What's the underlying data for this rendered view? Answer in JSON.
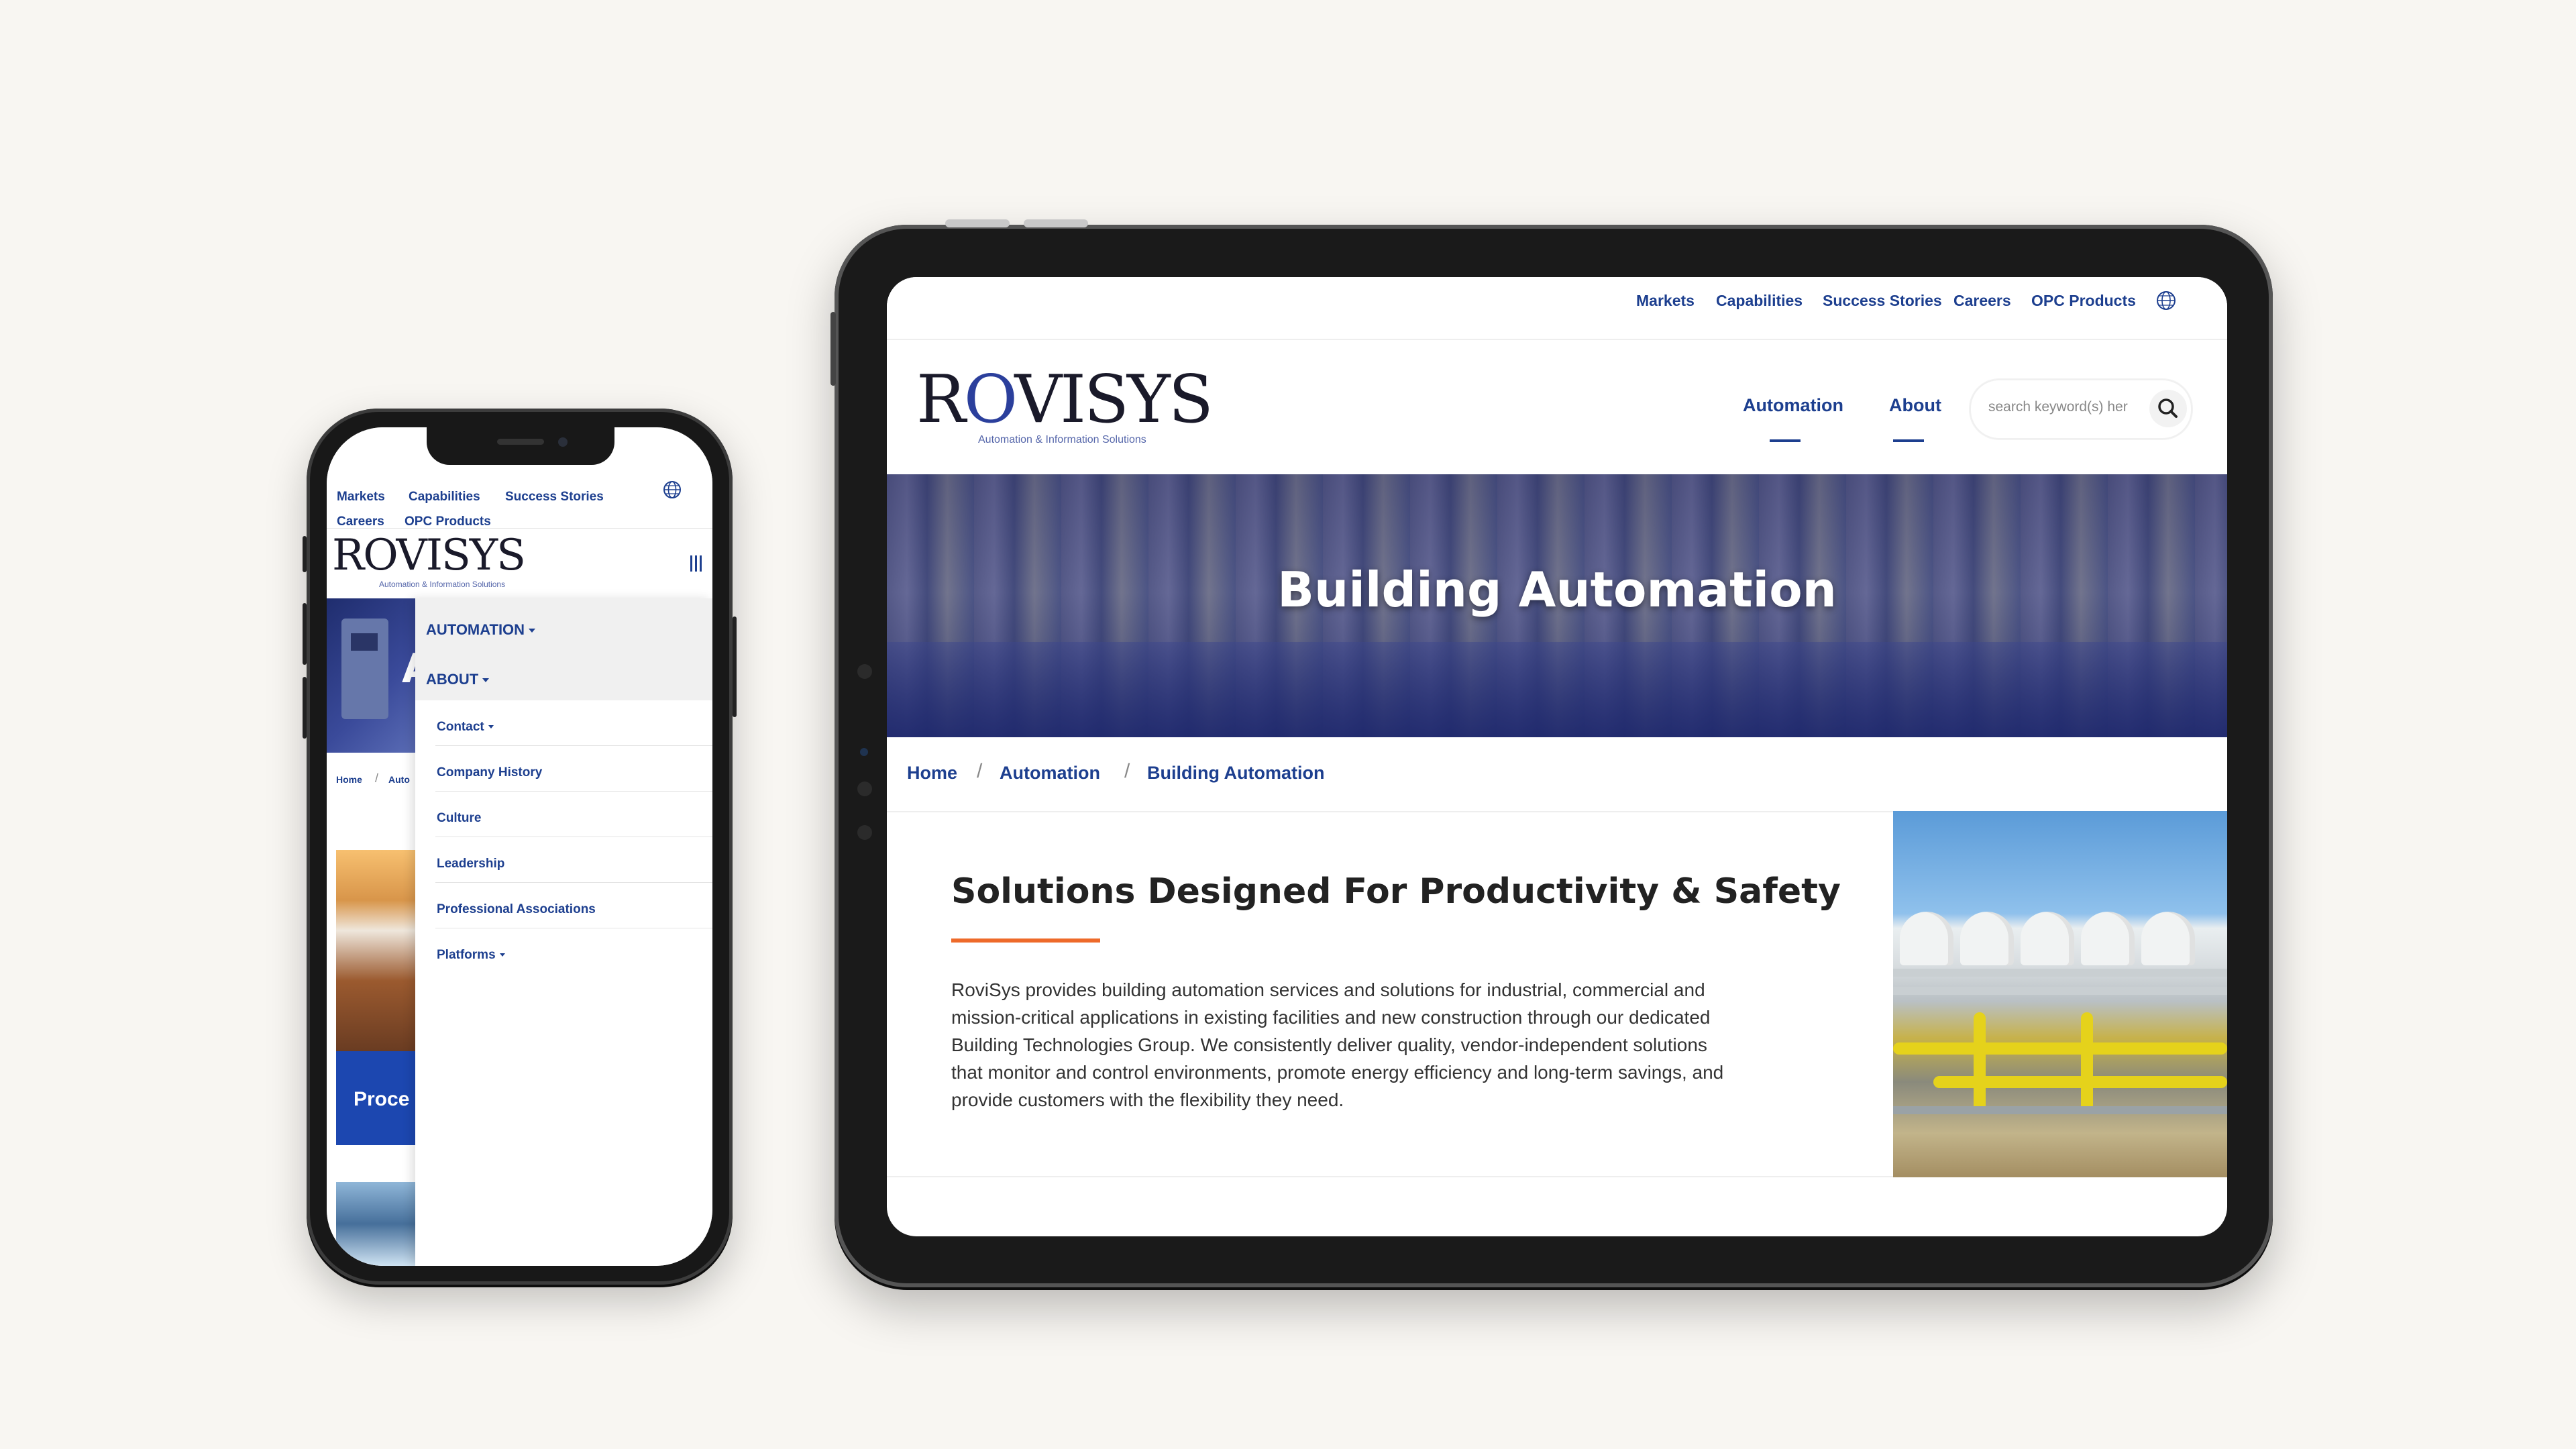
{
  "phone": {
    "utility_links": [
      "Markets",
      "Capabilities",
      "Success Stories",
      "Careers",
      "OPC Products"
    ],
    "logo": {
      "wordmark": "ROVISYS",
      "tagline": "Automation & Information Solutions"
    },
    "breadcrumb": [
      "Home",
      "/",
      "Auto"
    ],
    "hero_partial_text": "A",
    "card_partial_text": "Proce",
    "menu": {
      "top_items": [
        "AUTOMATION",
        "ABOUT"
      ],
      "about_items": [
        "Contact",
        "Company History",
        "Culture",
        "Leadership",
        "Professional Associations",
        "Platforms"
      ]
    }
  },
  "tablet": {
    "utility_links": [
      "Markets",
      "Capabilities",
      "Success Stories",
      "Careers",
      "OPC Products"
    ],
    "logo": {
      "wordmark_left": "R",
      "wordmark_o": "O",
      "wordmark_right": "VISYS",
      "tagline": "Automation & Information Solutions"
    },
    "nav": [
      "Automation",
      "About"
    ],
    "search": {
      "placeholder": "search keyword(s) her"
    },
    "hero_title": "Building Automation",
    "breadcrumb": [
      "Home",
      "Automation",
      "Building Automation"
    ],
    "section": {
      "title": "Solutions Designed For Productivity & Safety",
      "body_lines": [
        "RoviSys provides building automation services and solutions for industrial, commercial and",
        "mission-critical applications in existing facilities and new construction through our dedicated",
        "Building Technologies Group. We consistently deliver quality, vendor-independent solutions",
        "that monitor and control environments, promote energy efficiency and long-term savings, and",
        "provide customers with the flexibility they need."
      ]
    }
  },
  "colors": {
    "brand_blue": "#1d3f8f",
    "accent_orange": "#ee6a2a",
    "background": "#f8f6f2"
  },
  "icons": {
    "globe": "globe-icon",
    "search": "search-icon",
    "menu": "hamburger-icon"
  }
}
